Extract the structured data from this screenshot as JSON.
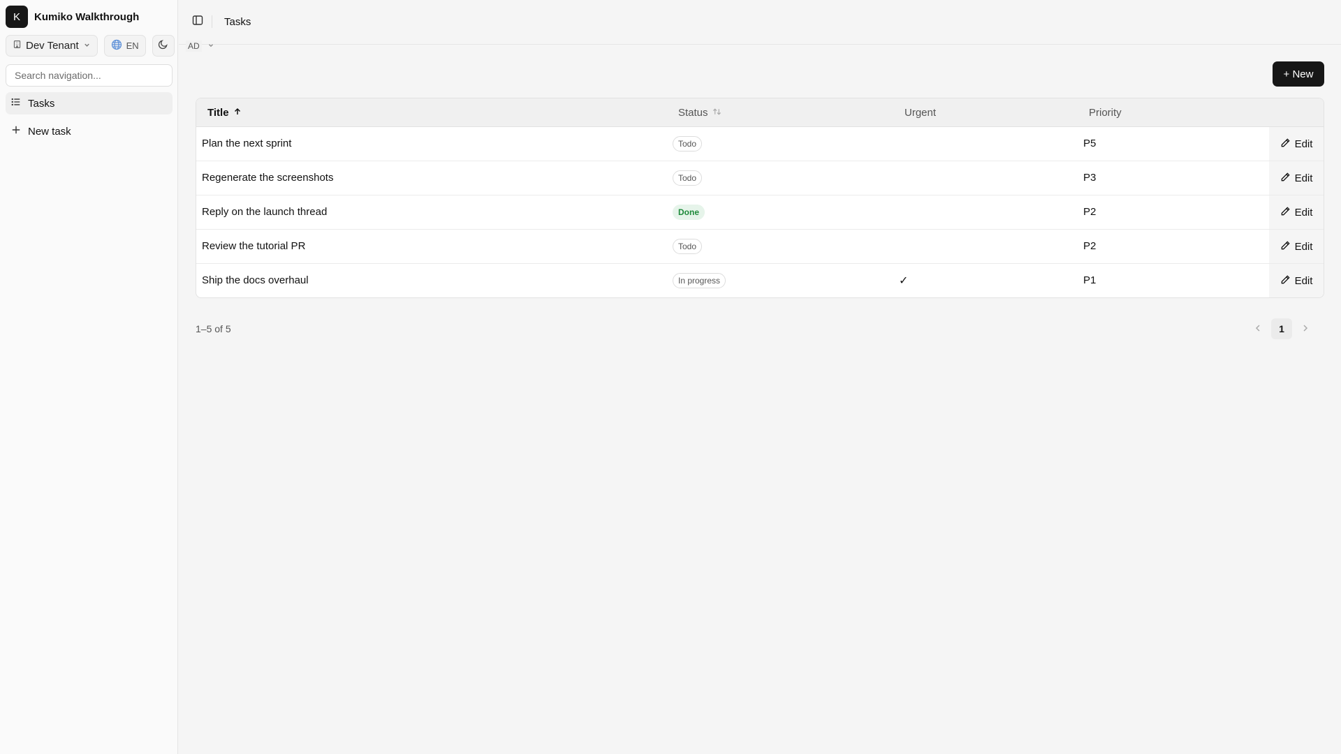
{
  "app": {
    "logo_letter": "K",
    "name": "Kumiko Walkthrough"
  },
  "sidebar": {
    "tenant": "Dev Tenant",
    "language": "EN",
    "search_placeholder": "Search navigation...",
    "items": [
      {
        "label": "Tasks",
        "icon": "list-icon",
        "active": true
      },
      {
        "label": "New task",
        "icon": "plus-icon",
        "active": false
      }
    ]
  },
  "topbar": {
    "breadcrumb": "Tasks",
    "user_initials": "AD"
  },
  "toolbar": {
    "new_label": "+ New"
  },
  "table": {
    "columns": {
      "title": "Title",
      "status": "Status",
      "urgent": "Urgent",
      "priority": "Priority"
    },
    "sort": {
      "column": "title",
      "direction": "asc"
    },
    "edit_label": "Edit",
    "rows": [
      {
        "title": "Plan the next sprint",
        "status": "Todo",
        "urgent": "",
        "priority": "P5"
      },
      {
        "title": "Regenerate the screenshots",
        "status": "Todo",
        "urgent": "",
        "priority": "P3"
      },
      {
        "title": "Reply on the launch thread",
        "status": "Done",
        "urgent": "",
        "priority": "P2"
      },
      {
        "title": "Review the tutorial PR",
        "status": "Todo",
        "urgent": "",
        "priority": "P2"
      },
      {
        "title": "Ship the docs overhaul",
        "status": "In progress",
        "urgent": "✓",
        "priority": "P1"
      }
    ]
  },
  "pagination": {
    "summary": "1–5 of 5",
    "current_page": "1"
  },
  "colors": {
    "primary": "#171717",
    "done_bg": "#e6f4ea",
    "done_text": "#1f8a3b",
    "background": "#f5f5f5"
  }
}
